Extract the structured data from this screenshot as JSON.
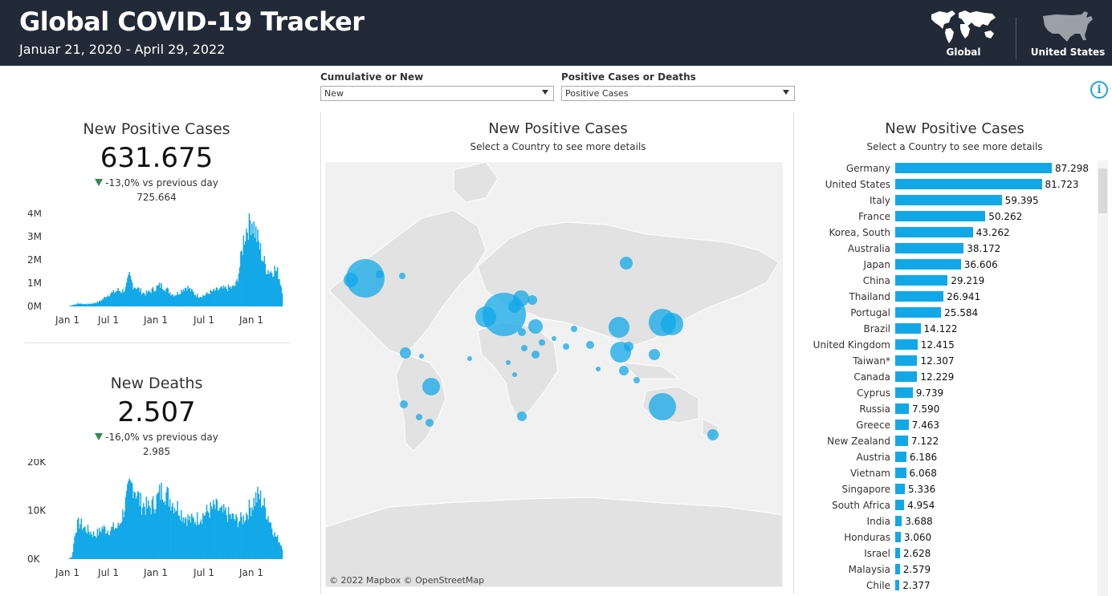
{
  "header": {
    "title": "Global COVID-19 Tracker",
    "subtitle": "Januar 21, 2020 - April 29, 2022",
    "nav": [
      {
        "label": "Global",
        "icon": "world-map-icon"
      },
      {
        "label": "United States",
        "icon": "us-map-icon"
      }
    ]
  },
  "filters": {
    "cumulative": {
      "label": "Cumulative or New",
      "value": "New"
    },
    "measure": {
      "label": "Positive Cases or Deaths",
      "value": "Positive Cases"
    }
  },
  "kpi_cases": {
    "title": "New Positive Cases",
    "value": "631.675",
    "delta": "-13,0% vs previous day",
    "previous": "725.664",
    "y_ticks": [
      "4M",
      "3M",
      "2M",
      "1M",
      "0M"
    ],
    "x_ticks": [
      "Jan 1",
      "Jul 1",
      "Jan 1",
      "Jul 1",
      "Jan 1"
    ]
  },
  "kpi_deaths": {
    "title": "New Deaths",
    "value": "2.507",
    "delta": "-16,0% vs previous day",
    "previous": "2.985",
    "y_ticks": [
      "20K",
      "10K",
      "0K"
    ],
    "x_ticks": [
      "Jan 1",
      "Jul 1",
      "Jan 1",
      "Jul 1",
      "Jan 1"
    ]
  },
  "map": {
    "title": "New Positive Cases",
    "subtitle": "Select a Country to see more details",
    "credit": "© 2022 Mapbox © OpenStreetMap"
  },
  "bars": {
    "title": "New Positive Cases",
    "subtitle": "Select a Country to see more details",
    "color": "#12a8e8"
  },
  "chart_data": [
    {
      "type": "bar",
      "title": "New Positive Cases",
      "ylim": [
        0,
        4000000
      ],
      "xlabel": "",
      "ylabel": "",
      "x_ticks": [
        "Jan 1",
        "Jul 1",
        "Jan 1",
        "Jul 1",
        "Jan 1"
      ],
      "note_series": "daily new positive cases Jan 2020 - Apr 2022",
      "profile": [
        0,
        0,
        0,
        0,
        0.05,
        0.1,
        0.12,
        0.1,
        0.1,
        0.12,
        0.15,
        0.2,
        0.3,
        0.45,
        0.55,
        0.6,
        0.7,
        0.65,
        0.75,
        1.3,
        0.9,
        0.8,
        0.65,
        0.55,
        0.6,
        0.7,
        0.8,
        0.9,
        0.85,
        0.7,
        0.55,
        0.5,
        0.6,
        0.75,
        0.85,
        0.7,
        0.55,
        0.45,
        0.45,
        0.5,
        0.6,
        0.65,
        0.7,
        0.75,
        0.75,
        0.8,
        0.8,
        0.95,
        1.8,
        3.0,
        3.5,
        3.8,
        3.2,
        2.6,
        2.0,
        1.6,
        1.5,
        1.6,
        1.4,
        0.7
      ]
    },
    {
      "type": "bar",
      "title": "New Deaths",
      "ylim": [
        0,
        20000
      ],
      "xlabel": "",
      "ylabel": "",
      "x_ticks": [
        "Jan 1",
        "Jul 1",
        "Jan 1",
        "Jul 1",
        "Jan 1"
      ],
      "note_series": "daily new deaths Jan 2020 - Apr 2022",
      "profile": [
        0,
        0,
        0,
        0,
        0.5,
        6.5,
        7.5,
        6.5,
        6.0,
        5.5,
        5.0,
        5.5,
        6.5,
        6.0,
        6.0,
        6.5,
        6.5,
        8.5,
        11.5,
        14.5,
        15.5,
        13.5,
        11.5,
        11.0,
        10.5,
        11.0,
        12.0,
        13.5,
        14.5,
        13.0,
        12.0,
        11.0,
        10.5,
        9.0,
        8.5,
        8.0,
        8.0,
        8.5,
        9.0,
        9.5,
        10.0,
        10.5,
        10.5,
        9.5,
        9.5,
        9.0,
        8.5,
        8.0,
        8.0,
        8.5,
        10.0,
        11.0,
        12.5,
        13.0,
        11.5,
        9.5,
        7.5,
        5.0,
        4.0,
        2.5
      ]
    },
    {
      "type": "bar",
      "title": "New Positive Cases",
      "subtitle": "Select a Country to see more details",
      "categories": [
        "Germany",
        "United States",
        "Italy",
        "France",
        "Korea, South",
        "Australia",
        "Japan",
        "China",
        "Thailand",
        "Portugal",
        "Brazil",
        "United Kingdom",
        "Taiwan*",
        "Canada",
        "Cyprus",
        "Russia",
        "Greece",
        "New Zealand",
        "Austria",
        "Vietnam",
        "Singapore",
        "South Africa",
        "India",
        "Honduras",
        "Israel",
        "Malaysia",
        "Chile"
      ],
      "values": [
        87298,
        81723,
        59395,
        50262,
        43262,
        38172,
        36606,
        29219,
        26941,
        25584,
        14122,
        12415,
        12307,
        12229,
        9739,
        7590,
        7463,
        7122,
        6186,
        6068,
        5336,
        4954,
        3688,
        3060,
        2628,
        2579,
        2377
      ],
      "labels": [
        "87.298",
        "81.723",
        "59.395",
        "50.262",
        "43.262",
        "38.172",
        "36.606",
        "29.219",
        "26.941",
        "25.584",
        "14.122",
        "12.415",
        "12.307",
        "12.229",
        "9.739",
        "7.590",
        "7.463",
        "7.122",
        "6.186",
        "6.068",
        "5.336",
        "4.954",
        "3.688",
        "3.060",
        "2.628",
        "2.579",
        "2.377"
      ]
    }
  ]
}
